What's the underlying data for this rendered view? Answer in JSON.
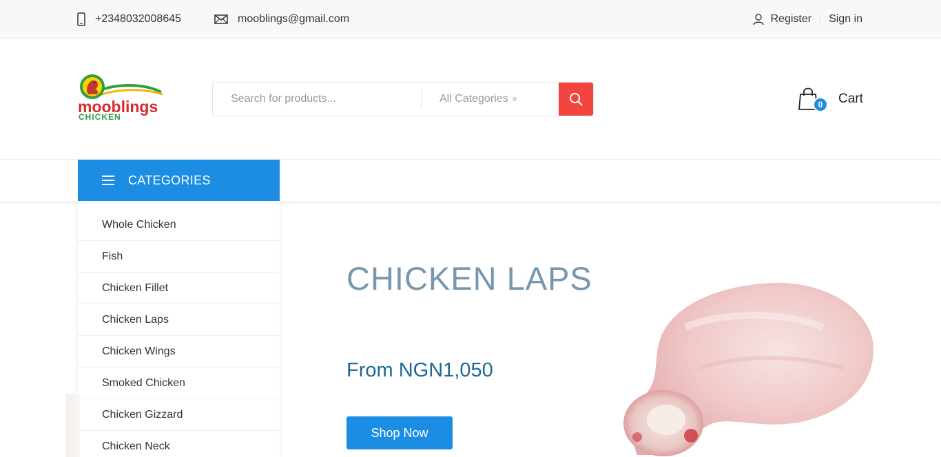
{
  "topbar": {
    "phone": "+2348032008645",
    "email": "mooblings@gmail.com",
    "register": "Register",
    "signin": "Sign in"
  },
  "header": {
    "logo_text_main": "mooblings",
    "logo_text_sub": "CHICKEN",
    "search_placeholder": "Search for products...",
    "category_select": "All Categories",
    "cart_count": "0",
    "cart_label": "Cart"
  },
  "nav": {
    "categories_label": "CATEGORIES"
  },
  "categories": [
    "Whole Chicken",
    "Fish",
    "Chicken Fillet",
    "Chicken Laps",
    "Chicken Wings",
    "Smoked Chicken",
    "Chicken Gizzard",
    "Chicken Neck"
  ],
  "hero": {
    "title": "CHICKEN LAPS",
    "price": "From NGN1,050",
    "button": "Shop Now"
  },
  "colors": {
    "accent_blue": "#1b8ee4",
    "search_red": "#f1453d",
    "hero_title": "#7697ad",
    "hero_price": "#1d6a95"
  }
}
